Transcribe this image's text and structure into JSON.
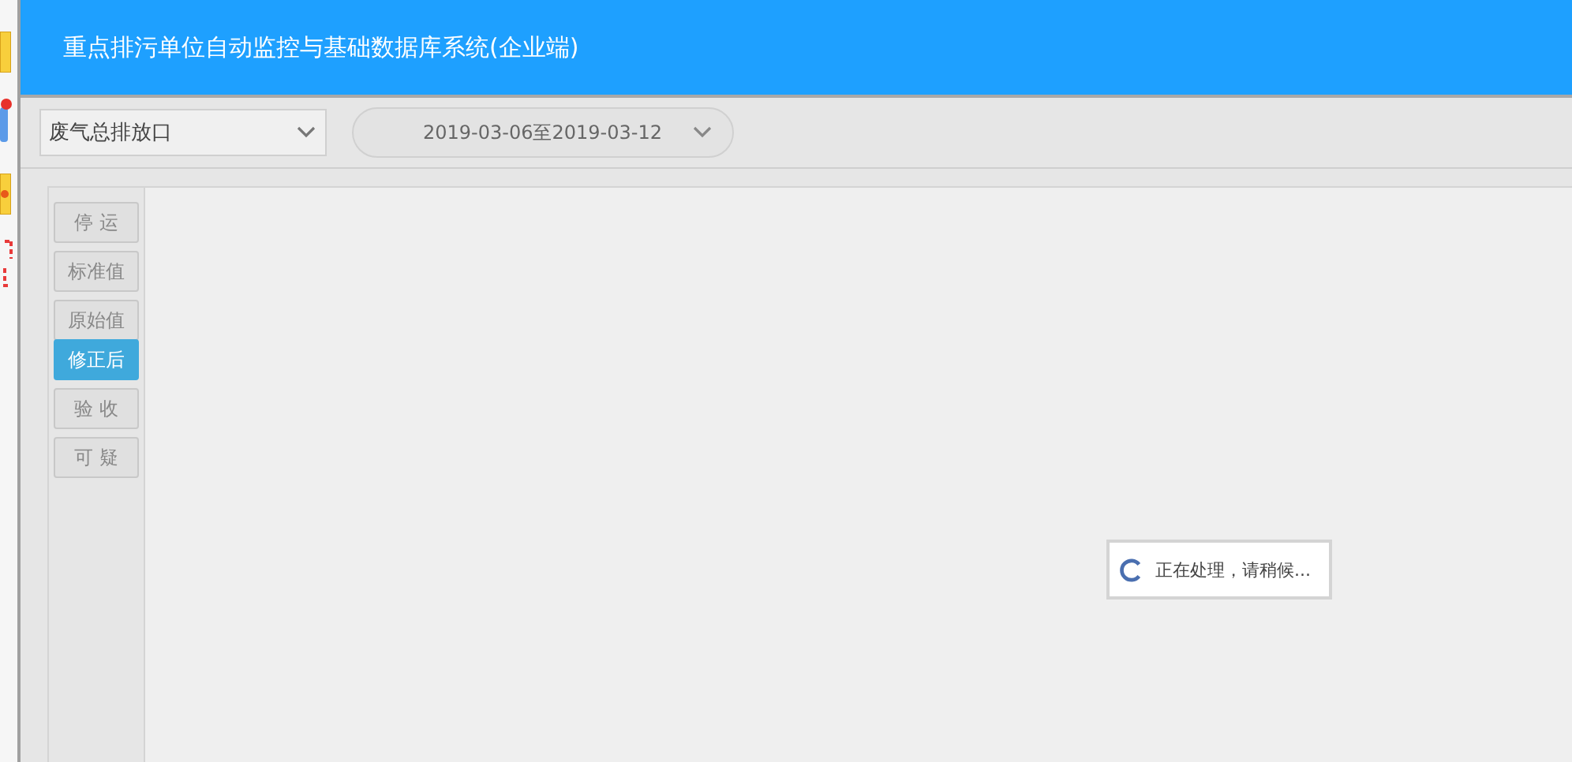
{
  "window": {
    "title": "重点排污单位自动监控与基础数据库系统(企业端)"
  },
  "outlet_select": {
    "value": "废气总排放口"
  },
  "date_range_select": {
    "value": "2019-03-06至2019-03-12"
  },
  "side_buttons": [
    {
      "label": "停 运",
      "selected": false
    },
    {
      "label": "标准值",
      "selected": false
    },
    {
      "label": "原始值",
      "selected": false
    },
    {
      "label": "修正后",
      "selected": true
    },
    {
      "label": "验 收",
      "selected": false
    },
    {
      "label": "可 疑",
      "selected": false
    }
  ],
  "loading": {
    "message": "正在处理，请稍候..."
  }
}
